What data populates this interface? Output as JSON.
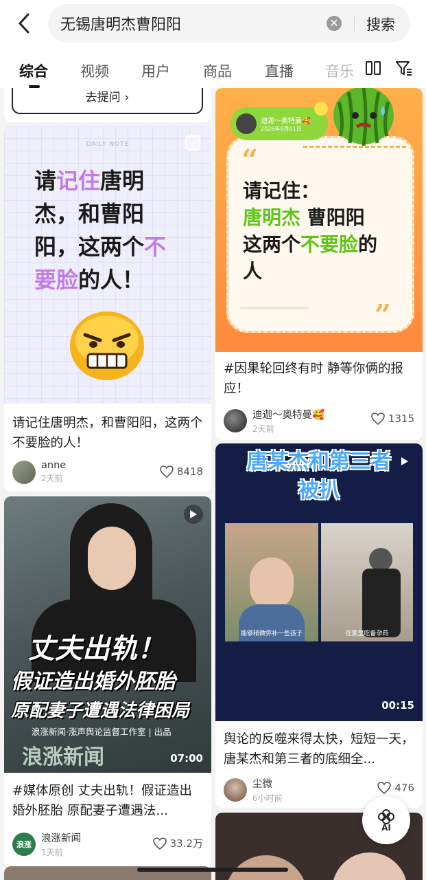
{
  "search": {
    "query": "无锡唐明杰曹阳阳",
    "button": "搜索"
  },
  "tabs": [
    {
      "label": "综合",
      "active": true
    },
    {
      "label": "视频"
    },
    {
      "label": "用户"
    },
    {
      "label": "商品"
    },
    {
      "label": "直播"
    },
    {
      "label": "音乐"
    }
  ],
  "ask_button": "去提问",
  "posts": [
    {
      "title": "请记住唐明杰，和曹阳阳，这两个不要脸的人！",
      "author": "anne",
      "time": "2天前",
      "likes": "8418",
      "cover": {
        "header": "DAILY NOTE",
        "line1a": "请",
        "line1b": "记住",
        "line1c": "唐明",
        "line2": "杰，和曹阳",
        "line3a": "阳，这两个",
        "line3b": "不",
        "line4a": "要脸",
        "line4b": "的人！"
      }
    },
    {
      "title": "#因果轮回终有时  静等你俩的报应！",
      "author": "迪迦～奥特曼🥰",
      "time": "2天前",
      "likes": "1315",
      "cover": {
        "bubble_name": "迪迦～奥特曼🥰",
        "bubble_date": "2026年8月01日",
        "line1": "请记住：",
        "line2a": "唐明杰",
        "line2b": "曹阳阳",
        "line3a": "这两个",
        "line3b": "不要脸",
        "line3c": "的",
        "line4": "人"
      }
    },
    {
      "title": "舆论的反噬来得太快，短短一天，唐某杰和第三者的底细全...",
      "author": "尘微",
      "time": "6小时前",
      "likes": "476",
      "cover": {
        "headline1": "唐某杰和第三者",
        "headline2": "被扒",
        "duration": "00:15",
        "sub1": "能够稍微弥补一些孩子",
        "sub2": "在家里吃备孕药"
      }
    },
    {
      "title": "#媒体原创 丈夫出轨！假证造出婚外胚胎 原配妻子遭遇法...",
      "author": "浪涨新闻",
      "time": "1天前",
      "likes": "33.2万",
      "cover": {
        "line1": "丈夫出轨！",
        "line2": "假证造出婚外胚胎",
        "line3": "原配妻子遭遇法律困局",
        "credit": "浪涨新闻·涨声舆论监督工作室 | 出品",
        "duration": "07:00",
        "logo_text": "浪涨新闻"
      }
    }
  ],
  "ai_label": "AI",
  "colors": {
    "purple": "#c07be8",
    "green": "#5fc419",
    "orange": "#ff8a3d"
  }
}
